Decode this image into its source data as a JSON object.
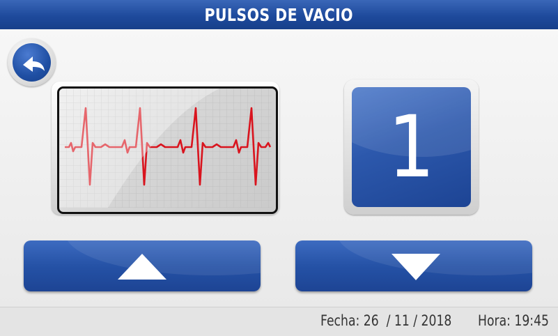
{
  "header": {
    "title": "PULSOS DE VACIO"
  },
  "icons": {
    "back": "back-arrow-icon",
    "pulse": "heartbeat-monitor-icon",
    "up": "triangle-up-icon",
    "down": "triangle-down-icon"
  },
  "counter": {
    "value": "1"
  },
  "footer": {
    "date_text": "Fecha: 26  / 11 / 2018",
    "time_text": "Hora: 19:45"
  },
  "colors": {
    "accent_blue": "#1f4fa3",
    "pulse_red": "#d9141e"
  }
}
